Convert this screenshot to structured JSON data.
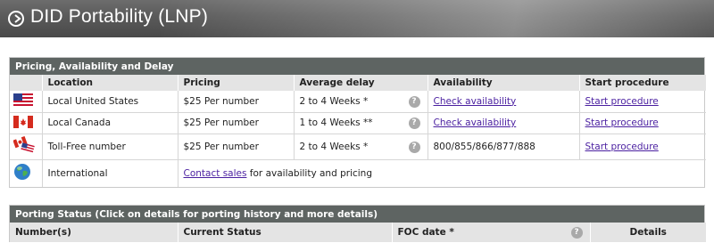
{
  "header": {
    "title": "DID Portability (LNP)",
    "icon": "circle-arrow-right-icon"
  },
  "pricing": {
    "title": "Pricing, Availability and Delay",
    "columns": [
      "",
      "Location",
      "Pricing",
      "Average delay",
      "Availability",
      "Start procedure"
    ],
    "rows": [
      {
        "icon": "us-flag-icon",
        "location": "Local United States",
        "pricing": "$25 Per number",
        "delay": "2 to 4 Weeks *",
        "availability": "Check availability",
        "procedure": "Start procedure"
      },
      {
        "icon": "canada-flag-icon",
        "location": "Local Canada",
        "pricing": "$25 Per number",
        "delay": "1 to 4 Weeks **",
        "availability": "Check availability",
        "procedure": "Start procedure"
      },
      {
        "icon": "us-canada-flags-icon",
        "location": "Toll-Free number",
        "pricing": "$25 Per number",
        "delay": "2 to 4 Weeks *",
        "availability": "800/855/866/877/888",
        "procedure": "Start procedure"
      },
      {
        "icon": "globe-icon",
        "location": "International",
        "contact_link": "Contact sales",
        "contact_text": " for availability and pricing"
      }
    ],
    "help_glyph": "?"
  },
  "porting": {
    "title": "Porting Status (Click on details for porting history and more details)",
    "columns": [
      "Number(s)",
      "Current Status",
      "FOC date *",
      "Details"
    ],
    "help_glyph": "?"
  },
  "colors": {
    "header_bg": "#5a5a5a",
    "section_head": "#5e6462",
    "column_head": "#e4e4e4",
    "link": "#4a1fa0"
  }
}
